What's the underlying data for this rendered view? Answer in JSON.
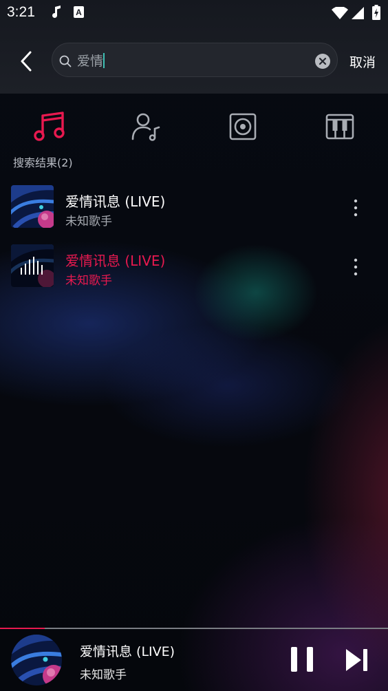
{
  "status_bar": {
    "time": "3:21",
    "icons": [
      "music-note-icon",
      "font-a-icon",
      "wifi-icon",
      "signal-icon",
      "battery-charging-icon"
    ]
  },
  "search": {
    "query": "爱情",
    "cancel_label": "取消"
  },
  "category_tabs": [
    {
      "icon": "music-note-icon",
      "active": true
    },
    {
      "icon": "singer-icon",
      "active": false
    },
    {
      "icon": "album-icon",
      "active": false
    },
    {
      "icon": "piano-icon",
      "active": false
    }
  ],
  "results": {
    "label": "搜索结果(2)",
    "items": [
      {
        "title": "爱情讯息 (LIVE)",
        "artist": "未知歌手",
        "playing": false,
        "cover": "abstract-blue-pink"
      },
      {
        "title": "爱情讯息 (LIVE)",
        "artist": "未知歌手",
        "playing": true,
        "cover": "equalizer-overlay"
      }
    ]
  },
  "player": {
    "title": "爱情讯息 (LIVE)",
    "artist": "未知歌手",
    "progress": 0.115,
    "state": "playing"
  },
  "colors": {
    "accent": "#e8194f",
    "background": "#05070c",
    "topbar": "#1a1d24"
  }
}
